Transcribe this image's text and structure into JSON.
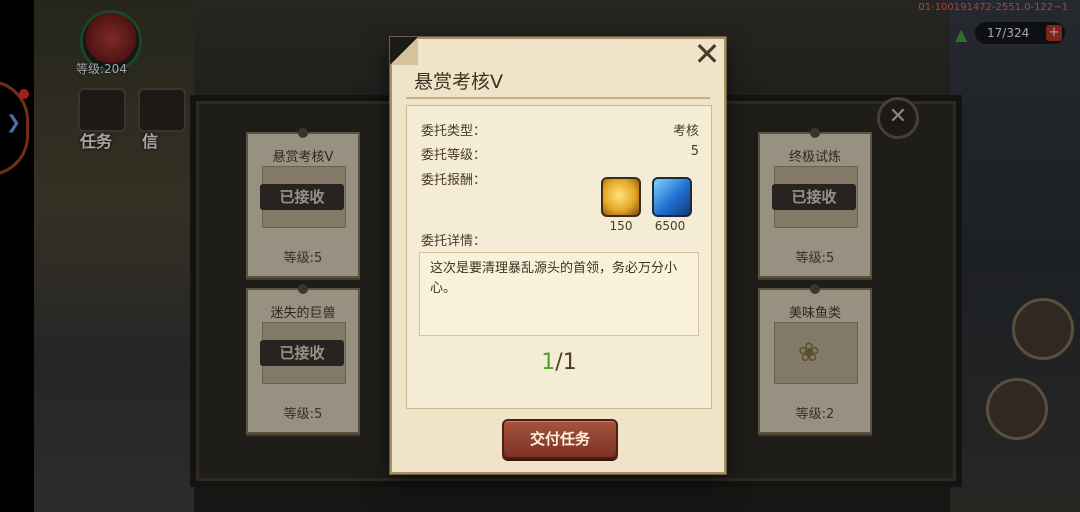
{
  "hud": {
    "player_level": "等级:204",
    "task_label": "任务",
    "side_label_2": "信",
    "counter": "17/324",
    "counter_plus": "+",
    "version": "01-100191472-2551.0-122~1"
  },
  "bg_cards": [
    {
      "title": "悬赏考核V",
      "stamp": "已接收",
      "level": "等级:5"
    },
    {
      "title": "迷失的巨兽",
      "stamp": "已接收",
      "level": "等级:5"
    },
    {
      "title": "终极试炼",
      "stamp": "已接收",
      "level": "等级:5"
    },
    {
      "title": "美味鱼类",
      "stamp": "",
      "level": "等级:2"
    }
  ],
  "dialog": {
    "title": "悬赏考核V",
    "close_icon": "close-icon",
    "type_label": "委托类型：",
    "type_value": "考核",
    "level_label": "委托等级：",
    "level_value": "5",
    "reward_label": "委托报酬：",
    "rewards": [
      {
        "icon": "gold-coin-icon",
        "amount": "150",
        "color": "#e6a726"
      },
      {
        "icon": "blue-crystal-icon",
        "amount": "6500",
        "color": "#1f6fd0"
      }
    ],
    "detail_label": "委托详情：",
    "detail_text": "这次是要清理暴乱源头的首领，务必万分小心。",
    "progress_current": "1",
    "progress_total": "/1",
    "submit_label": "交付任务"
  },
  "colors": {
    "paper": "#efe4c8",
    "progress_green": "#4fa02e",
    "button": "#8e3d2c"
  }
}
